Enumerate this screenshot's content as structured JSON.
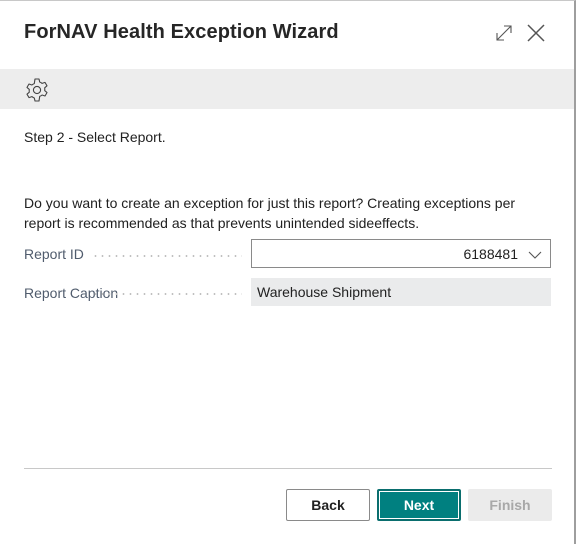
{
  "dialog": {
    "title": "ForNAV Health Exception Wizard",
    "icons": {
      "expand": "expand-icon",
      "close": "close-icon",
      "settings": "gear-icon"
    }
  },
  "content": {
    "step_label": "Step 2 - Select Report.",
    "description": "Do you want to create an exception for just this report? Creating exceptions per report is recommended as that prevents unintended sideeffects.",
    "fields": [
      {
        "label": "Report ID",
        "value": "6188481",
        "type": "dropdown"
      },
      {
        "label": "Report Caption",
        "value": "Warehouse Shipment",
        "type": "read-only"
      }
    ]
  },
  "footer": {
    "back_label": "Back",
    "next_label": "Next",
    "finish_label": "Finish",
    "finish_enabled": false
  },
  "colors": {
    "accent": "#008080",
    "toolbar_bg": "#ededed",
    "readonly_bg": "#eaebec",
    "label_text": "#505c6d"
  }
}
